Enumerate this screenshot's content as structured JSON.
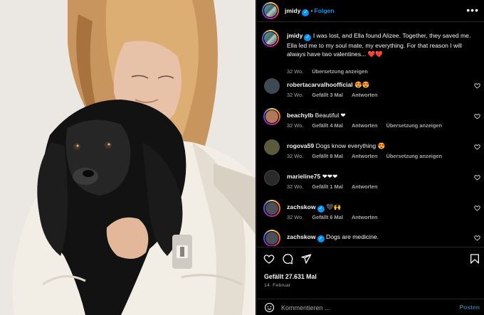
{
  "post": {
    "author": "jmidy",
    "separator": "•",
    "follow_label": "Folgen",
    "more_label": "•••"
  },
  "caption": {
    "username": "jmidy",
    "text": "I was lost, and Ella found Alizee. Together, they saved me. Ella led me to my soul mate, my everything. For that reason I will always have two valentines... ❤️❤️",
    "time": "32 Wo.",
    "translate": "Übersetzung anzeigen"
  },
  "comments": [
    {
      "username": "robertacarvalhoofficial",
      "verified": false,
      "text": "😍😍",
      "time": "32 Wo.",
      "likes": "Gefällt 3 Mal",
      "reply": "Antworten",
      "translate": "",
      "avatar_color": "#3d4a52"
    },
    {
      "username": "beachylb",
      "verified": false,
      "text": "Beautiful ❤",
      "time": "32 Wo.",
      "likes": "Gefällt 4 Mal",
      "reply": "Antworten",
      "translate": "Übersetzung anzeigen",
      "avatar_color": "#b07a5a"
    },
    {
      "username": "rogova59",
      "verified": false,
      "text": "Dogs know everything 😍",
      "time": "32 Wo.",
      "likes": "Gefällt 8 Mal",
      "reply": "Antworten",
      "translate": "Übersetzung anzeigen",
      "avatar_color": "#5c5a3c"
    },
    {
      "username": "marieline75",
      "verified": false,
      "text": "❤❤❤",
      "time": "32 Wo.",
      "likes": "Gefällt 1 Mal",
      "reply": "Antworten",
      "translate": "",
      "avatar_color": "#2a2a2a"
    },
    {
      "username": "zachskow",
      "verified": true,
      "text": "🖤🙌",
      "time": "32 Wo.",
      "likes": "Gefällt 6 Mal",
      "reply": "Antworten",
      "translate": "",
      "avatar_color": "#4b4f57"
    },
    {
      "username": "zachskow",
      "verified": true,
      "text": "Dogs are medicine.",
      "time": "",
      "likes": "",
      "reply": "",
      "translate": "",
      "avatar_color": "#4b4f57"
    }
  ],
  "stats": {
    "likes": "Gefällt 27.631 Mal",
    "date": "14. Februar"
  },
  "composer": {
    "placeholder": "Kommentieren ...",
    "post_label": "Posten"
  },
  "colors": {
    "accent": "#0095f6",
    "background": "#000000",
    "muted_text": "#a8a8a8"
  },
  "icons": {
    "like": "heart-icon",
    "comment": "comment-icon",
    "share": "share-icon",
    "save": "bookmark-icon",
    "emoji": "emoji-icon",
    "verified": "verified-badge-icon"
  }
}
